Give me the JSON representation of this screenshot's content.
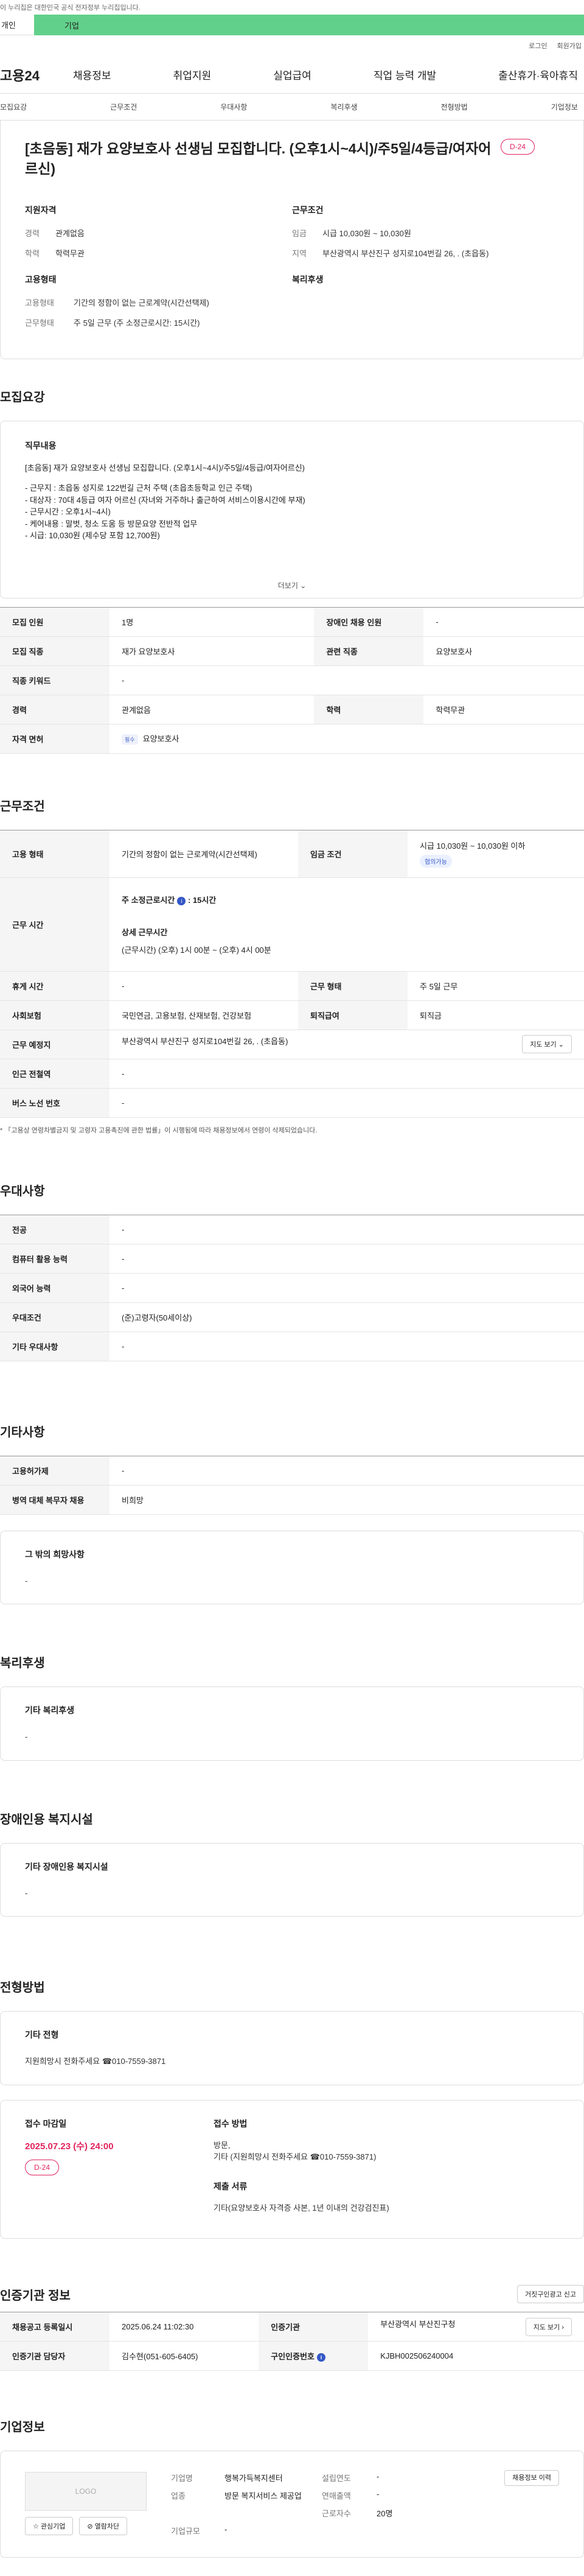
{
  "notice": "이 누리집은 대한민국 공식 전자정부 누리집입니다.",
  "top_tabs": [
    "개인",
    "기업"
  ],
  "util": [
    "로그인",
    "회원가입"
  ],
  "logo": "고용24",
  "gnb": [
    "채용정보",
    "취업지원",
    "실업급여",
    "직업 능력 개발",
    "출산휴가·육아휴직"
  ],
  "subnav": [
    "모집요강",
    "근무조건",
    "우대사항",
    "복리후생",
    "전형방법",
    "기업정보"
  ],
  "job": {
    "title": "[초음동] 재가 요양보호사 선생님 모집합니다. (오후1시~4시)/주5일/4등급/여자어르신)",
    "dday": "D-24",
    "qual_title": "지원자격",
    "qual": [
      {
        "k": "경력",
        "v": "관계없음"
      },
      {
        "k": "학력",
        "v": "학력무관"
      }
    ],
    "cond_title": "근무조건",
    "cond": [
      {
        "k": "임금",
        "v": "시급 10,030원 ~ 10,030원"
      },
      {
        "k": "지역",
        "v": "부산광역시 부산진구 성지로104번길 26, . (초읍동)"
      }
    ],
    "emp_title": "고용형태",
    "emp": [
      {
        "k": "고용형태",
        "v": "기간의 정함이 없는 근로계약(시간선택제)"
      },
      {
        "k": "근무형태",
        "v": "주 5일 근무 (주 소정근로시간: 15시간)"
      }
    ],
    "welfare_title": "복리후생"
  },
  "sections": {
    "recruit": "모집요강",
    "work": "근무조건",
    "prefer": "우대사항",
    "etc": "기타사항",
    "welfare": "복리후생",
    "disabled": "장애인용 복지시설",
    "screening": "전형방법",
    "agency": "인증기관 정보",
    "company": "기업정보"
  },
  "duty": {
    "title": "직무내용",
    "lines": [
      "[초음동] 재가 요양보호사 선생님 모집합니다. (오후1시~4시)/주5일/4등급/여자어르신)",
      "",
      "- 근무지 : 초읍동 성지로 122번길 근처 주택 (초읍초등학교 인근 주택)",
      "- 대상자 : 70대 4등급 여자 어르신 (자녀와 거주하나 출근하여 서비스이용시간에 부재)",
      "- 근무시간 : 오후1시~4시)",
      "- 케어내용 : 말벗, 청소 도움 등 방문요양 전반적 업무",
      "- 시급: 10,030원 (제수당 포함 12,700원)"
    ],
    "more": "더보기 ⌄"
  },
  "recruit_table": {
    "r1": [
      "모집 인원",
      "1명",
      "장애인 채용 인원",
      "-"
    ],
    "r2": [
      "모집 직종",
      "재가 요양보호사",
      "관련 직종",
      "요양보호사"
    ],
    "r3": [
      "직종 키워드",
      "-"
    ],
    "r4": [
      "경력",
      "관계없음",
      "학력",
      "학력무관"
    ],
    "r5": [
      "자격 면허",
      "필수",
      "요양보호사"
    ]
  },
  "work_table": {
    "r1": [
      "고용 형태",
      "기간의 정함이 없는 근로계약(시간선택제)",
      "임금 조건",
      "시급 10,030원 ~ 10,030원 이하",
      "협의가능"
    ],
    "r2_k": "근무 시간",
    "r2_week": "주 소정근로시간",
    "r2_week_v": ": 15시간",
    "r2_detail_t": "상세 근무시간",
    "r2_detail_v": "(근무시간) (오후) 1시 00분 ~ (오후) 4시 00분",
    "r3": [
      "휴게 시간",
      "-",
      "근무 형태",
      "주 5일 근무"
    ],
    "r4": [
      "사회보험",
      "국민연금, 고용보험, 산재보험, 건강보험",
      "퇴직급여",
      "퇴직금"
    ],
    "r5": [
      "근무 예정지",
      "부산광역시 부산진구 성지로104번길 26, . (초읍동)",
      "지도 보기 ⌄"
    ],
    "r6": [
      "인근 전철역",
      "-"
    ],
    "r7": [
      "버스 노선 번호",
      "-"
    ],
    "footnote": "* 「고용상 연령차별금지 및 고령자 고용촉진에 관한 법률」이 시행됨에 따라 채용정보에서 연령이 삭제되었습니다."
  },
  "prefer_table": [
    [
      "전공",
      "-"
    ],
    [
      "컴퓨터 활용 능력",
      "-"
    ],
    [
      "외국어 능력",
      "-"
    ],
    [
      "우대조건",
      "(준)고령자(50세이상)"
    ],
    [
      "기타 우대사항",
      "-"
    ]
  ],
  "etc_table": [
    [
      "고용허가제",
      "-"
    ],
    [
      "병역 대체 복무자 채용",
      "비희망"
    ]
  ],
  "etc_box": {
    "title": "그 밖의 희망사항",
    "value": "-"
  },
  "welfare_box": {
    "title": "기타 복리후생",
    "value": "-"
  },
  "disabled_box": {
    "title": "기타 장애인용 복지시설",
    "value": "-"
  },
  "screen_box": {
    "title": "기타 전형",
    "value": "지원희망시 전화주세요 ☎010-7559-3871"
  },
  "apply": {
    "deadline_t": "접수 마감일",
    "deadline": "2025.07.23 (수) 24:00",
    "dday": "D-24",
    "method_t": "접수 방법",
    "method": [
      "방문,",
      "기타 (지원희망시 전화주세요 ☎010-7559-3871)"
    ],
    "docs_t": "제출 서류",
    "docs": "기타(요양보호사 자격증 사본, 1년 이내의 건강검진표)"
  },
  "agency": {
    "btn": "거짓구인광고 신고",
    "r1": [
      "채용공고 등록일시",
      "2025.06.24 11:02:30",
      "인증기관",
      "부산광역시 부산진구청",
      "지도 보기 ›"
    ],
    "r2": [
      "인증기관 담당자",
      "김수현(051-605-6405)",
      "구인인증번호",
      "KJBH002506240004"
    ]
  },
  "company": {
    "logo": "LOGO",
    "fav": "☆ 관심기업",
    "block": "⊘ 열람차단",
    "history": "채용정보 이력",
    "rows": [
      [
        "기업명",
        "행복가득복지센터",
        "설립연도",
        "-"
      ],
      [
        "업종",
        "방문 복지서비스 제공업",
        "연매출액",
        "-"
      ],
      [
        "",
        "",
        "근로자수",
        "20명"
      ],
      [
        "기업규모",
        "-",
        "",
        ""
      ]
    ]
  }
}
